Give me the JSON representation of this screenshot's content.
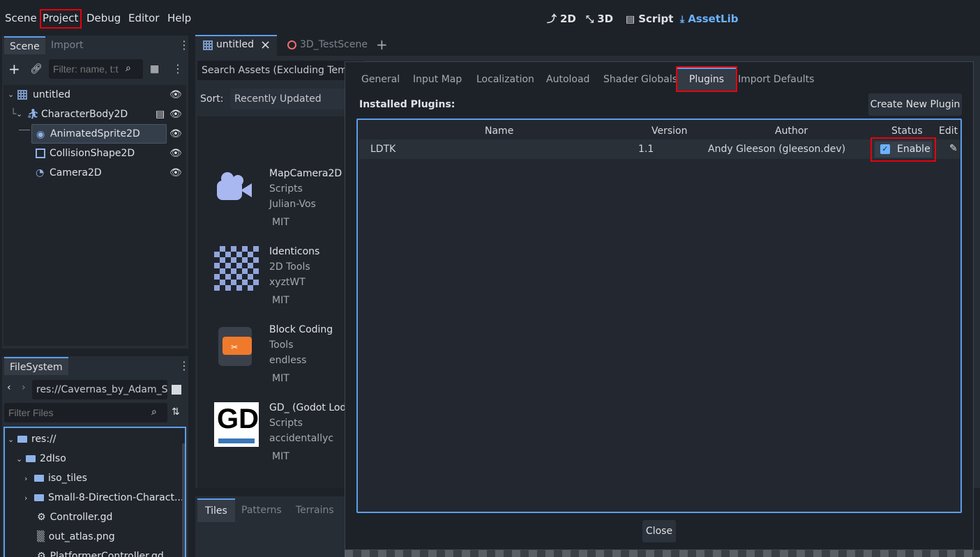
{
  "menu": {
    "scene": "Scene",
    "project": "Project",
    "debug": "Debug",
    "editor": "Editor",
    "help": "Help"
  },
  "workspaces": {
    "d2": "2D",
    "d3": "3D",
    "script": "Script",
    "assetlib": "AssetLib"
  },
  "scene_dock": {
    "tabs": [
      "Scene",
      "Import"
    ],
    "filter_placeholder": "Filter: name, t:t",
    "nodes": [
      {
        "name": "untitled"
      },
      {
        "name": "CharacterBody2D"
      },
      {
        "name": "AnimatedSprite2D"
      },
      {
        "name": "CollisionShape2D"
      },
      {
        "name": "Camera2D"
      }
    ]
  },
  "filesystem": {
    "tab": "FileSystem",
    "path": "res://Cavernas_by_Adam_S",
    "filter_placeholder": "Filter Files",
    "items": [
      {
        "name": "res://"
      },
      {
        "name": "2dIso"
      },
      {
        "name": "iso_tiles"
      },
      {
        "name": "Small-8-Direction-Charact..."
      },
      {
        "name": "Controller.gd"
      },
      {
        "name": "out_atlas.png"
      },
      {
        "name": "PlatformerController.gd"
      }
    ]
  },
  "editor_tabs": [
    {
      "label": "untitled"
    },
    {
      "label": "3D_TestScene"
    }
  ],
  "assetlib": {
    "search_placeholder": "Search Assets (Excluding Templ",
    "sort_label": "Sort:",
    "sort_value": "Recently Updated",
    "assets": [
      {
        "title": "MapCamera2D",
        "category": "Scripts",
        "author": "Julian-Vos",
        "license": "MIT"
      },
      {
        "title": "Identicons",
        "category": "2D Tools",
        "author": "xyztWT",
        "license": "MIT"
      },
      {
        "title": "Block Coding",
        "category": "Tools",
        "author": "endless",
        "license": "MIT"
      },
      {
        "title": "GD_ (Godot Loda",
        "category": "Scripts",
        "author": "accidentallyc",
        "license": "MIT"
      }
    ],
    "gd_logo_text": "GD"
  },
  "bottom_tabs": [
    "Tiles",
    "Patterns",
    "Terrains"
  ],
  "project_settings": {
    "tabs": [
      "General",
      "Input Map",
      "Localization",
      "Autoload",
      "Shader Globals",
      "Plugins",
      "Import Defaults"
    ],
    "installed_label": "Installed Plugins:",
    "create_button": "Create New Plugin",
    "columns": {
      "name": "Name",
      "version": "Version",
      "author": "Author",
      "status": "Status",
      "edit": "Edit"
    },
    "plugins": [
      {
        "name": "LDTK",
        "version": "1.1",
        "author": "Andy Gleeson (gleeson.dev)",
        "status": "Enable",
        "enabled": true
      }
    ],
    "close_button": "Close"
  },
  "colors": {
    "accent": "#5d9eea",
    "highlight": "#e8000b",
    "bg": "#1d2229",
    "panel": "#272d35"
  }
}
